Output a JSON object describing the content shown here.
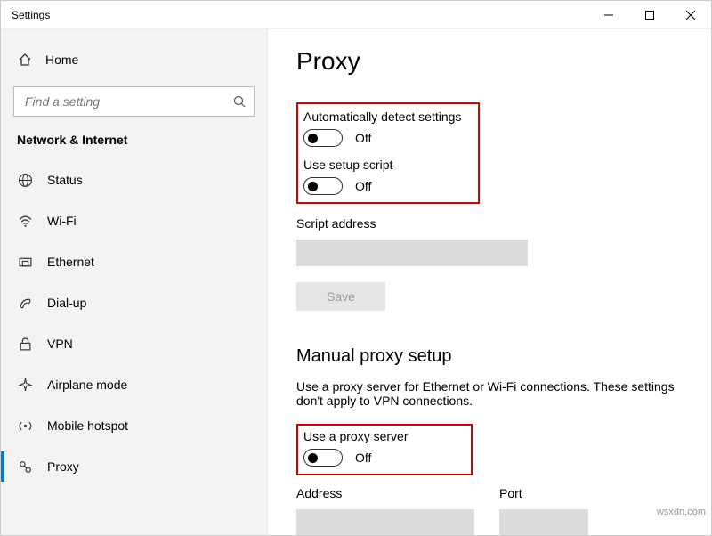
{
  "window": {
    "title": "Settings"
  },
  "sidebar": {
    "home": "Home",
    "search_placeholder": "Find a setting",
    "section": "Network & Internet",
    "items": [
      {
        "label": "Status"
      },
      {
        "label": "Wi-Fi"
      },
      {
        "label": "Ethernet"
      },
      {
        "label": "Dial-up"
      },
      {
        "label": "VPN"
      },
      {
        "label": "Airplane mode"
      },
      {
        "label": "Mobile hotspot"
      },
      {
        "label": "Proxy"
      }
    ]
  },
  "main": {
    "title": "Proxy",
    "auto_detect_label": "Automatically detect settings",
    "auto_detect_state": "Off",
    "setup_script_label": "Use setup script",
    "setup_script_state": "Off",
    "script_address_label": "Script address",
    "save_label": "Save",
    "manual_heading": "Manual proxy setup",
    "manual_desc": "Use a proxy server for Ethernet or Wi-Fi connections. These settings don't apply to VPN connections.",
    "use_proxy_label": "Use a proxy server",
    "use_proxy_state": "Off",
    "address_label": "Address",
    "port_label": "Port"
  },
  "watermark": "wsxdn.com"
}
